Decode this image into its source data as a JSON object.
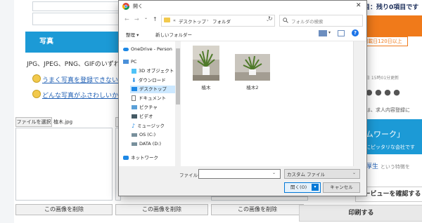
{
  "page": {
    "section_title": "写真",
    "file_types_text": "JPG、JPEG、PNG、GIFのいずれか",
    "tip_links": [
      "うまく写真を登録できない場合",
      "どんな写真がふさわしいか相談"
    ],
    "file_select_label": "ファイルを選択",
    "file_select_value": "植木.jpg",
    "delete_button_label": "この画像を削除"
  },
  "right_panel": {
    "banner_text": "目：残り0項目です",
    "badge_text": "掲載日120日以上",
    "updated_text": "日 15時01分更新",
    "dots": "● ● ● ●",
    "desc_text": "は、求人内容登録に",
    "work_text": "ムワーク」",
    "fit_text": "にピッタリな会社です",
    "welfare_text": "厚生",
    "welfare_suffix": "という特徴を",
    "preview_button": "ュービューを確認する",
    "print_button": "印刷する"
  },
  "dialog": {
    "title": "開く",
    "close_glyph": "✕",
    "path_prefix": "«",
    "path_items": [
      "デスクトップ",
      "フォルダ"
    ],
    "search_placeholder": "フォルダの検索",
    "organize_label": "整理 ▾",
    "new_folder_label": "新しいフォルダー",
    "nav_items": [
      "OneDrive - Person",
      "PC",
      "3D オブジェクト",
      "ダウンロード",
      "デスクトップ",
      "ドキュメント",
      "ピクチャ",
      "ビデオ",
      "ミュージック",
      "OS (C:)",
      "DATA (D:)",
      "ネットワーク"
    ],
    "selected_nav": "デスクトップ",
    "files": [
      {
        "name": "植木"
      },
      {
        "name": "植木2"
      }
    ],
    "filename_label": "ファイル名(N):",
    "filename_value": "",
    "filetype_value": "カスタム ファイル",
    "open_button": "開く(O)",
    "cancel_button": "キャンセル"
  },
  "colors": {
    "accent_blue": "#1c9ad6",
    "banner_orange": "#f07a1a",
    "selection": "#cce8ff",
    "link": "#1f5fb4"
  }
}
